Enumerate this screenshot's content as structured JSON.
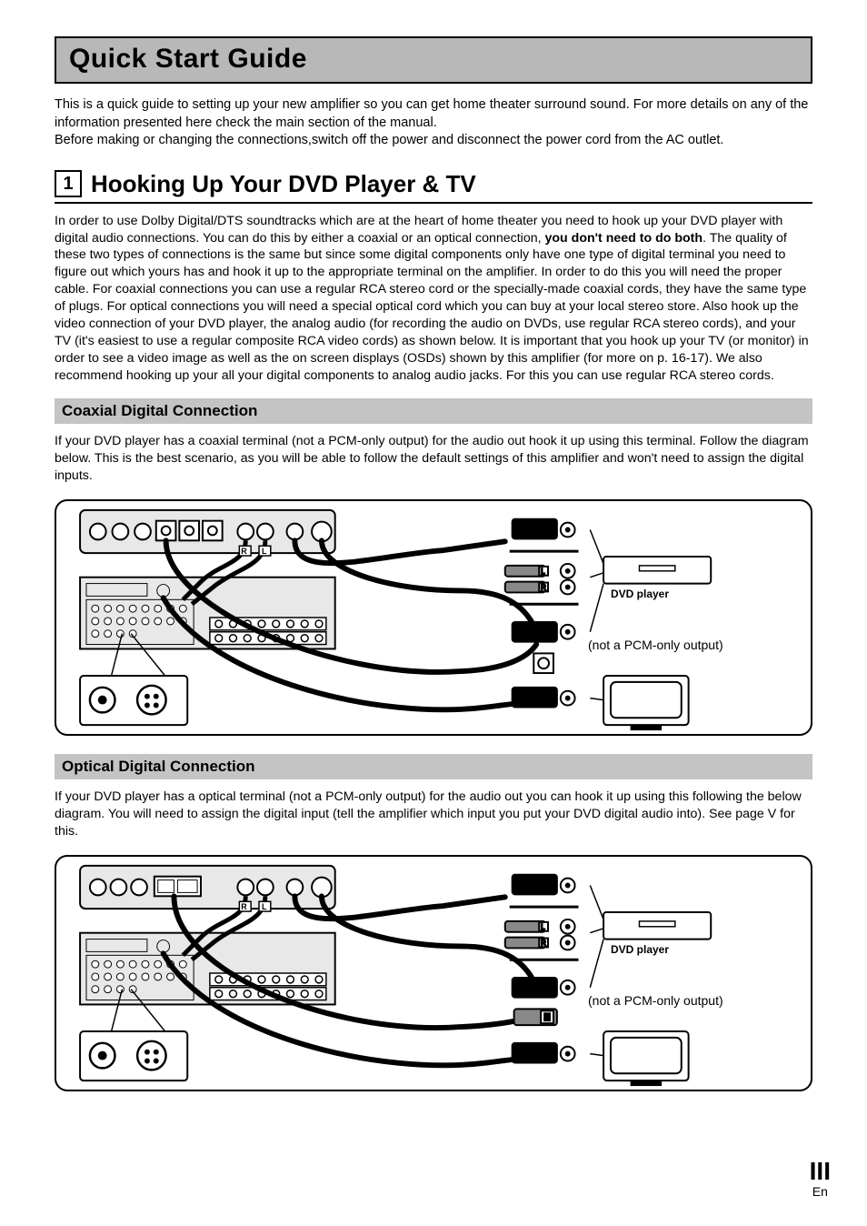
{
  "title": "Quick Start Guide",
  "intro_p1": "This is a quick guide to setting up your new amplifier so you can get home theater surround sound. For more details on any of the information presented here check the main section of the manual.",
  "intro_p2": "Before making or changing the connections,switch off the power and disconnect the power cord from the AC outlet.",
  "section1": {
    "number": "1",
    "heading": "Hooking Up Your DVD Player & TV",
    "body_pre": "In order to use Dolby Digital/DTS soundtracks which are at the heart of home theater you need to hook up your DVD player with digital audio connections. You can do this by either a coaxial or an optical connection, ",
    "body_bold": "you don't need to do both",
    "body_post": ". The quality of these two types of connections is the same but since some digital components only have one type of digital terminal you need to figure out which yours has and hook it up to the appropriate terminal on the amplifier. In order to do this you will need the proper cable. For coaxial connections you can use a  regular RCA stereo cord or the specially-made coaxial cords, they have the same type of plugs. For optical connections you will need a special optical cord which you can buy at your local stereo store. Also hook up the video connection of your DVD player, the analog audio (for recording the audio on DVDs, use regular RCA stereo cords), and your TV (it's easiest to use a regular composite RCA video cords) as shown below. It is important that you hook up your TV (or monitor) in order to see a video image as well as the on screen displays (OSDs) shown by this amplifier (for more on p. 16-17). We also recommend hooking up your all your digital components to analog audio jacks. For this you can use regular RCA stereo cords."
  },
  "coaxial": {
    "heading": "Coaxial Digital Connection",
    "body": "If your DVD player has a coaxial terminal (not a PCM-only output) for the audio out hook it up using this terminal. Follow the diagram below. This is the best scenario, as you will be able to follow the default settings of this amplifier and won't need to assign the digital inputs.",
    "dvd_label": "DVD player",
    "pcm_note": "(not a PCM-only output)",
    "l_label": "L",
    "r_label": "R"
  },
  "optical": {
    "heading": "Optical Digital Connection",
    "body": "If your DVD player has a optical terminal (not a PCM-only output) for the audio out you can hook it up using this following the below diagram. You will need to assign the digital input (tell the amplifier which input you put your DVD digital audio into). See page V for this.",
    "dvd_label": "DVD player",
    "pcm_note": "(not a PCM-only output)",
    "l_label": "L",
    "r_label": "R"
  },
  "page": {
    "roman": "III",
    "lang": "En"
  }
}
